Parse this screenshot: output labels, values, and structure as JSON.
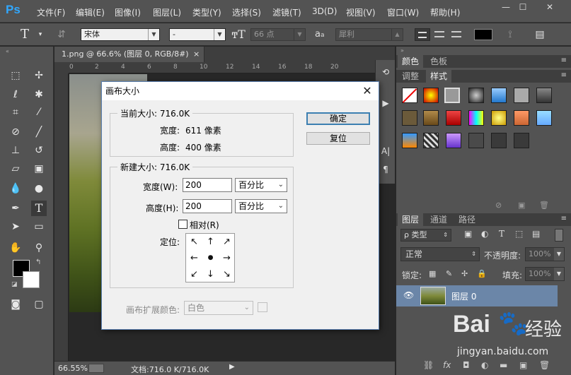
{
  "menubar": {
    "logo": "Ps",
    "items": [
      "文件(F)",
      "编辑(E)",
      "图像(I)",
      "图层(L)",
      "类型(Y)",
      "选择(S)",
      "滤镜(T)",
      "3D(D)",
      "视图(V)",
      "窗口(W)",
      "帮助(H)"
    ],
    "window_controls": [
      "—",
      "☐",
      "✕"
    ]
  },
  "options": {
    "font_family": "宋体",
    "font_style": "-",
    "font_size": "66 点",
    "aa_label": "a",
    "aa_sub": "a",
    "antialias": "犀利"
  },
  "document": {
    "tab_title": "1.png @ 66.6% (图层 0, RGB/8#)",
    "tab_close": "×",
    "ruler_ticks": [
      "0",
      "2",
      "4",
      "6",
      "8",
      "10",
      "12",
      "14",
      "16",
      "18",
      "20"
    ],
    "zoom": "66.55%",
    "doc_info": "文档:716.0 K/716.0K"
  },
  "dialog": {
    "title": "画布大小",
    "close": "✕",
    "current_size_legend": "当前大小: 716.0K",
    "width_label": "宽度:",
    "width_value": "611 像素",
    "height_label": "高度:",
    "height_value": "400 像素",
    "new_size_legend": "新建大小: 716.0K",
    "new_width_label": "宽度(W):",
    "new_width_value": "200",
    "new_height_label": "高度(H):",
    "new_height_value": "200",
    "unit": "百分比",
    "relative_label": "相对(R)",
    "anchor_label": "定位:",
    "anchor_arrows": [
      "↖",
      "↑",
      "↗",
      "←",
      "●",
      "→",
      "↙",
      "↓",
      "↘"
    ],
    "ext_color_label": "画布扩展颜色:",
    "ext_color_value": "白色",
    "ok_button": "确定",
    "reset_button": "复位"
  },
  "panels": {
    "color_tab": "颜色",
    "swatches_tab": "色板",
    "adjust_tab": "调整",
    "styles_tab": "样式",
    "layers_tab": "图层",
    "channels_tab": "通道",
    "paths_tab": "路径",
    "filter_kind": "ρ 类型",
    "blend_mode": "正常",
    "opacity_label": "不透明度:",
    "opacity_value": "100%",
    "lock_label": "锁定:",
    "fill_label": "填充:",
    "fill_value": "100%",
    "layer_name": "图层 0",
    "layer_fx": "fx"
  },
  "watermark": {
    "brand": "Bai",
    "brand2": "经验",
    "url": "jingyan.baidu.com"
  },
  "colors": {
    "ps_blue": "#31a8ff",
    "panel_bg": "#535353",
    "layer_selected": "#6b86a8"
  }
}
